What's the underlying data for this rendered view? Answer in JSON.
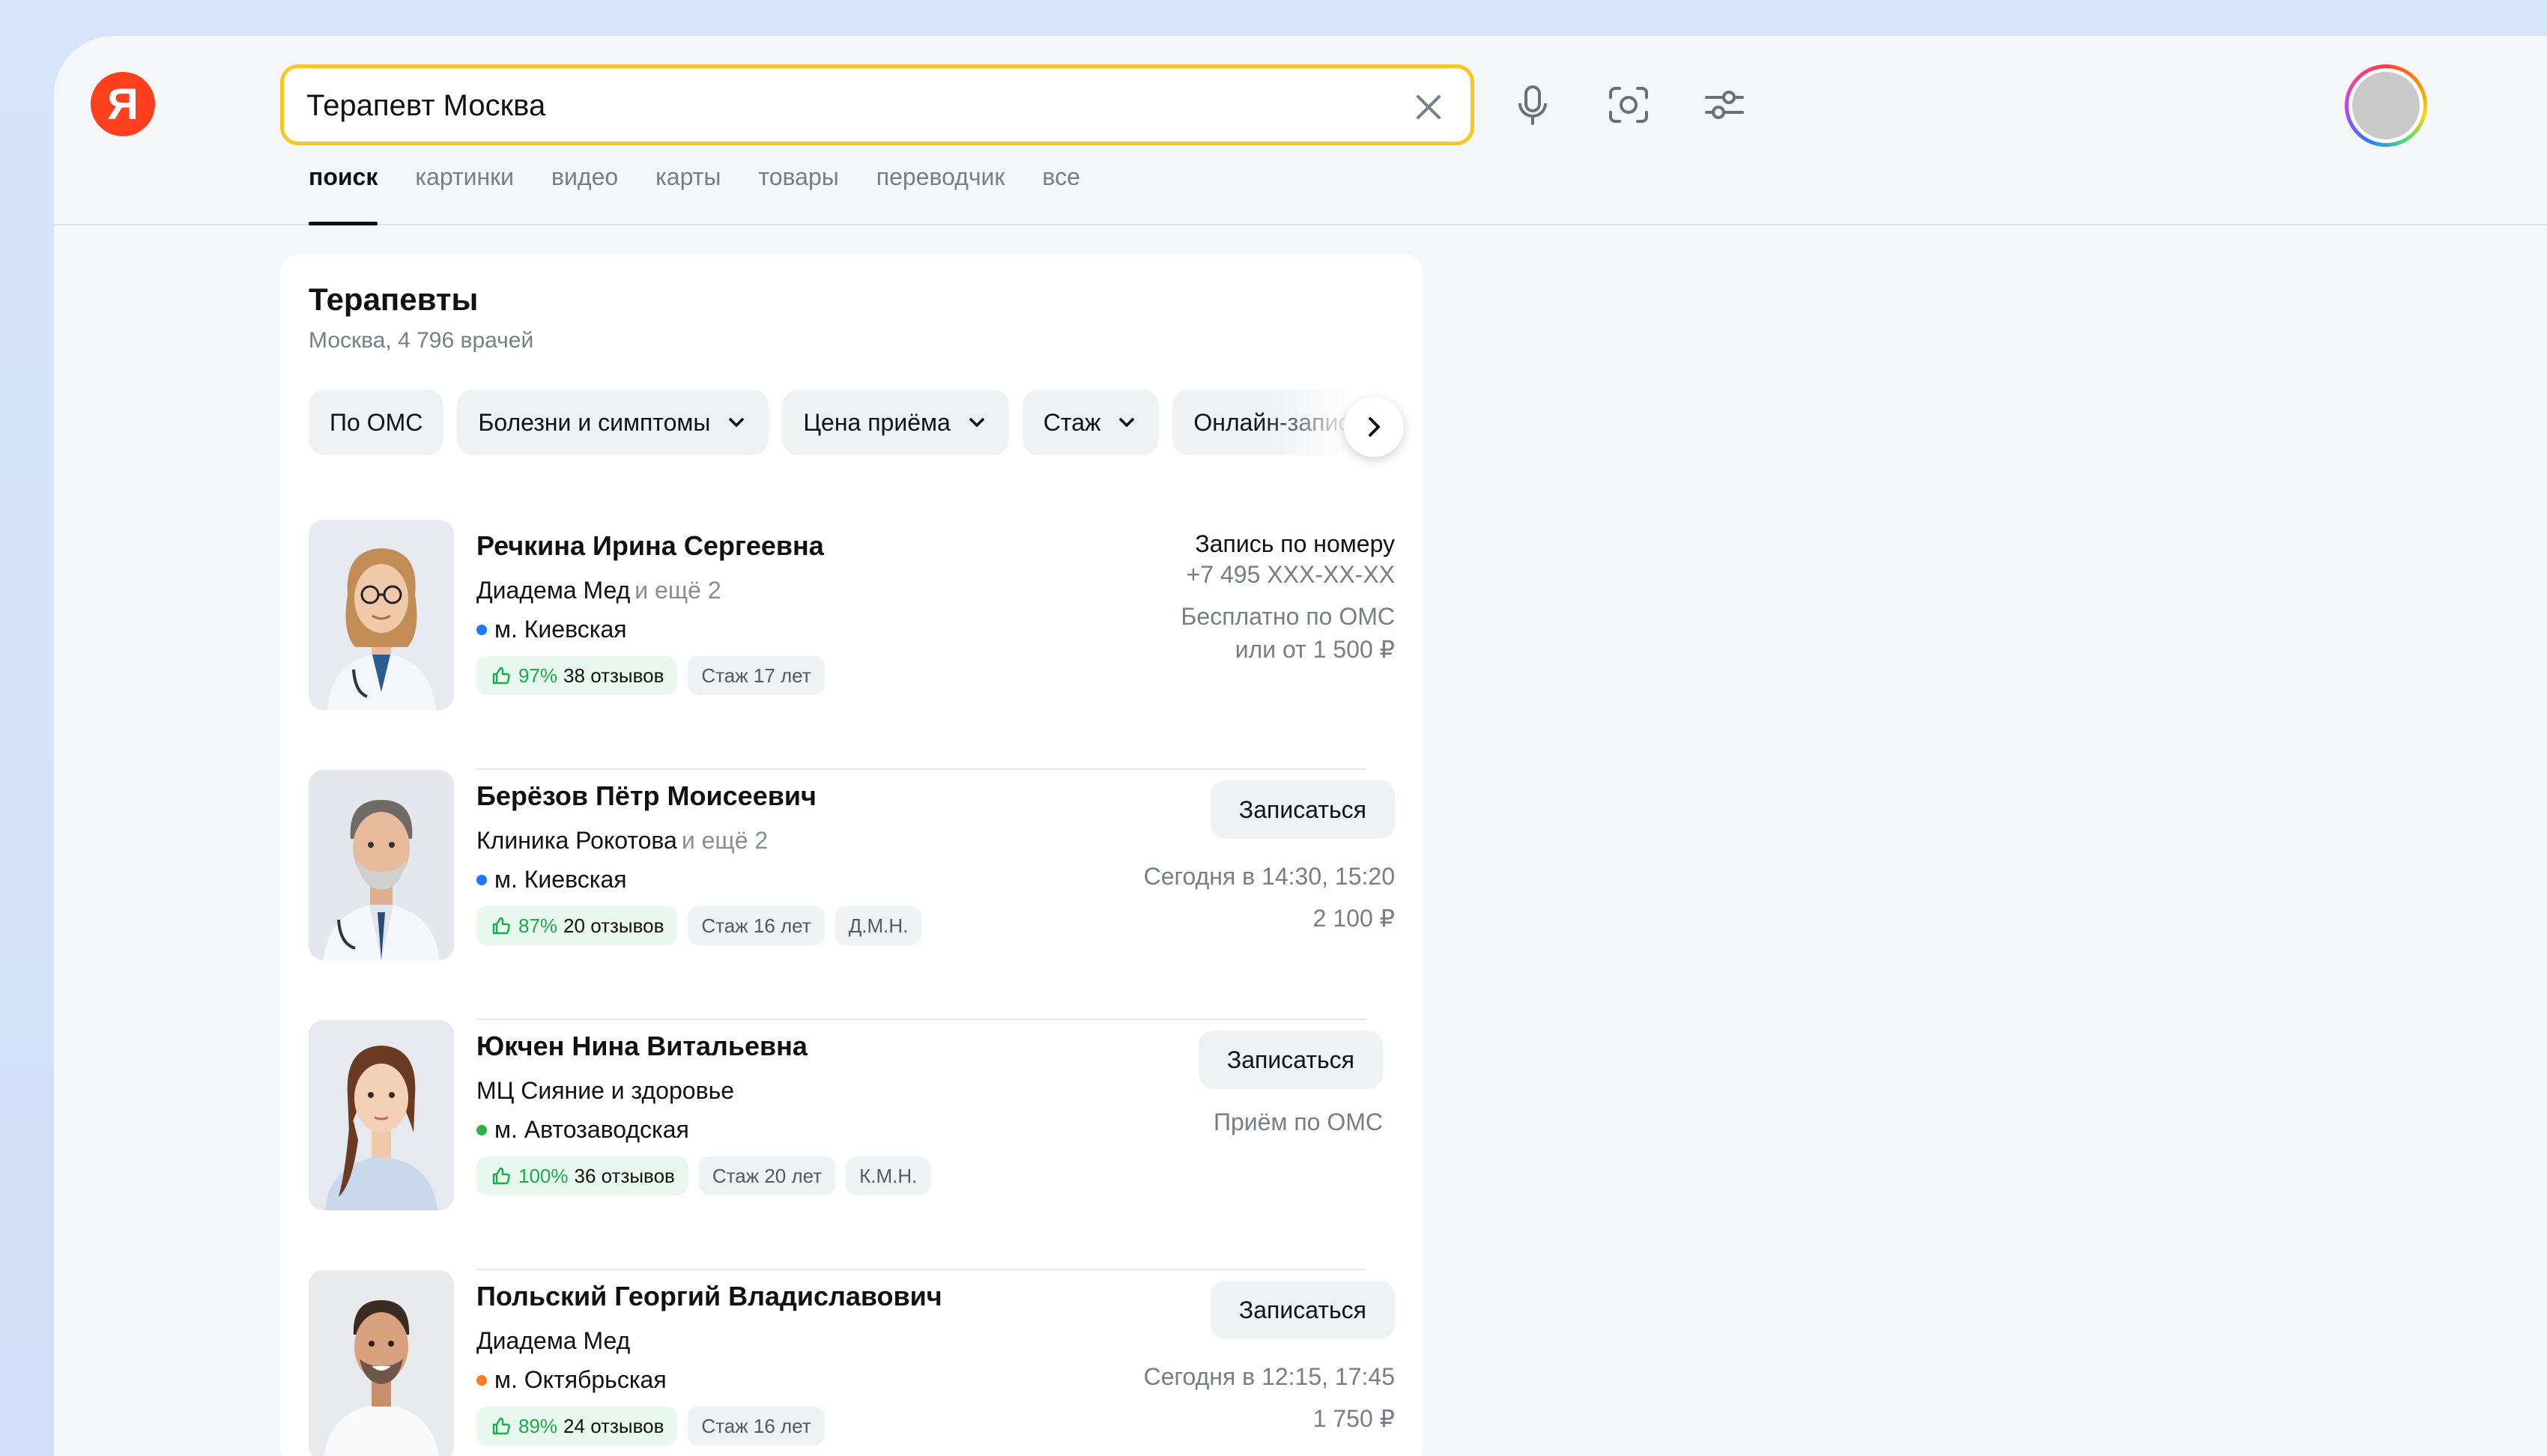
{
  "search": {
    "query": "Терапевт Москва",
    "logo": "Я"
  },
  "icons": {
    "clear": "close-icon",
    "voice": "microphone-icon",
    "camera": "camera-search-icon",
    "settings": "sliders-icon",
    "next": "chevron-right-icon"
  },
  "tabs": [
    {
      "label": "поиск",
      "active": true
    },
    {
      "label": "картинки"
    },
    {
      "label": "видео"
    },
    {
      "label": "карты"
    },
    {
      "label": "товары"
    },
    {
      "label": "переводчик"
    },
    {
      "label": "все"
    }
  ],
  "card": {
    "title": "Терапевты",
    "subtitle": "Москва, 4 796 врачей"
  },
  "filters": [
    {
      "label": "По ОМС",
      "dropdown": false
    },
    {
      "label": "Болезни и симптомы",
      "dropdown": true
    },
    {
      "label": "Цена приёма",
      "dropdown": true
    },
    {
      "label": "Стаж",
      "dropdown": true
    },
    {
      "label": "Онлайн-запись",
      "dropdown": false
    }
  ],
  "doctors": [
    {
      "name": "Речкина Ирина Сергеевна",
      "clinic": "Диадема Мед",
      "more": "и ещё 2",
      "metro": "м. Киевская",
      "metro_color": "#1e78ff",
      "rating": "97%",
      "reviews": "38 отзывов",
      "experience": "Стаж 17 лет",
      "degree": "",
      "booking": "Запись по номеру",
      "phone": "+7 495 XXX-XX-XX",
      "price_lines": [
        "Бесплатно по ОМС",
        "или от 1 500 ₽"
      ]
    },
    {
      "name": "Берёзов Пётр Моисеевич",
      "clinic": "Клиника Рокотова",
      "more": "и ещё 2",
      "metro": "м. Киевская",
      "metro_color": "#1e78ff",
      "rating": "87%",
      "reviews": "20 отзывов",
      "experience": "Стаж 16 лет",
      "degree": "Д.М.Н.",
      "button": "Записаться",
      "price_lines": [
        "Сегодня в 14:30, 15:20",
        "2 100 ₽"
      ]
    },
    {
      "name": "Юкчен Нина Витальевна",
      "clinic": "МЦ Сияние и здоровье",
      "more": "",
      "metro": "м. Автозаводская",
      "metro_color": "#2bb34a",
      "rating": "100%",
      "reviews": "36 отзывов",
      "experience": "Стаж 20 лет",
      "degree": "К.М.Н.",
      "button": "Записаться",
      "price_lines": [
        "Приём по ОМС"
      ]
    },
    {
      "name": "Польский Георгий Владиславович",
      "clinic": "Диадема Мед",
      "more": "",
      "metro": "м. Октябрьская",
      "metro_color": "#ff7a1a",
      "rating": "89%",
      "reviews": "24 отзывов",
      "experience": "Стаж 16 лет",
      "degree": "",
      "button": "Записаться",
      "price_lines": [
        "Сегодня в 12:15, 17:45",
        "1 750 ₽"
      ]
    }
  ],
  "colors": {
    "brand": "#fc3f1d",
    "search_border": "#f7c823",
    "rating_green": "#1aab4a"
  }
}
